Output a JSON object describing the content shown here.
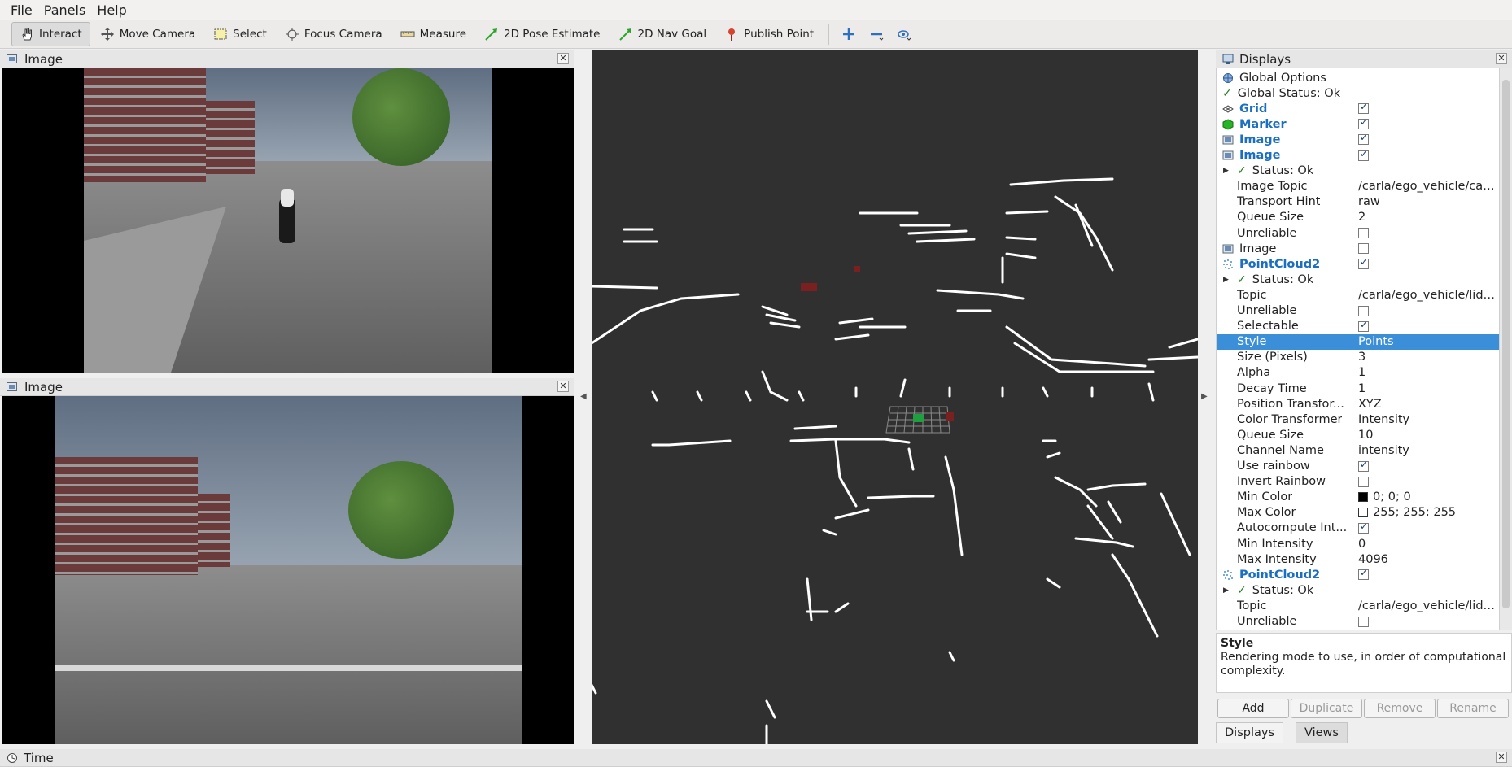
{
  "menu": [
    "File",
    "Panels",
    "Help"
  ],
  "toolbar": {
    "tools": [
      {
        "label": "Interact",
        "icon": "hand-icon",
        "active": true
      },
      {
        "label": "Move Camera",
        "icon": "move-camera-icon"
      },
      {
        "label": "Select",
        "icon": "select-box-icon"
      },
      {
        "label": "Focus Camera",
        "icon": "focus-camera-icon"
      },
      {
        "label": "Measure",
        "icon": "ruler-icon"
      },
      {
        "label": "2D Pose Estimate",
        "icon": "green-arrow-icon"
      },
      {
        "label": "2D Nav Goal",
        "icon": "green-arrow-icon"
      },
      {
        "label": "Publish Point",
        "icon": "pin-icon"
      }
    ],
    "extra_icons": [
      "add-tool-icon",
      "remove-tool-icon",
      "view-options-icon"
    ]
  },
  "image_panels": [
    {
      "title": "Image"
    },
    {
      "title": "Image"
    }
  ],
  "displays": {
    "title": "Displays",
    "rows": [
      {
        "name": "Global Options",
        "icon": "globe-icon"
      },
      {
        "name": "Global Status: Ok",
        "icon": "check-icon"
      },
      {
        "name": "Grid",
        "icon": "grid-icon",
        "display": true,
        "checked": true
      },
      {
        "name": "Marker",
        "icon": "marker-cube-icon",
        "display": true,
        "checked": true
      },
      {
        "name": "Image",
        "icon": "image-icon",
        "display": true,
        "checked": true
      },
      {
        "name": "Image",
        "icon": "image-icon",
        "display": true,
        "checked": true
      },
      {
        "name": "Status: Ok",
        "sub": true,
        "expander": true,
        "icon": "check-icon"
      },
      {
        "name": "Image Topic",
        "sub": true,
        "value": "/carla/ego_vehicle/cam..."
      },
      {
        "name": "Transport Hint",
        "sub": true,
        "value": "raw"
      },
      {
        "name": "Queue Size",
        "sub": true,
        "value": "2"
      },
      {
        "name": "Unreliable",
        "sub": true,
        "checked": false
      },
      {
        "name": "Image",
        "icon": "image-icon",
        "plain": true,
        "checked": false
      },
      {
        "name": "PointCloud2",
        "icon": "pointcloud-icon",
        "display": true,
        "checked": true
      },
      {
        "name": "Status: Ok",
        "sub": true,
        "expander": true,
        "icon": "check-icon"
      },
      {
        "name": "Topic",
        "sub": true,
        "value": "/carla/ego_vehicle/lida..."
      },
      {
        "name": "Unreliable",
        "sub": true,
        "checked": false
      },
      {
        "name": "Selectable",
        "sub": true,
        "checked": true
      },
      {
        "name": "Style",
        "sub": true,
        "value": "Points",
        "selected": true
      },
      {
        "name": "Size (Pixels)",
        "sub": true,
        "value": "3"
      },
      {
        "name": "Alpha",
        "sub": true,
        "value": "1"
      },
      {
        "name": "Decay Time",
        "sub": true,
        "value": "1"
      },
      {
        "name": "Position Transfor...",
        "sub": true,
        "value": "XYZ"
      },
      {
        "name": "Color Transformer",
        "sub": true,
        "value": "Intensity"
      },
      {
        "name": "Queue Size",
        "sub": true,
        "value": "10"
      },
      {
        "name": "Channel Name",
        "sub": true,
        "value": "intensity"
      },
      {
        "name": "Use rainbow",
        "sub": true,
        "checked": true
      },
      {
        "name": "Invert Rainbow",
        "sub": true,
        "checked": false
      },
      {
        "name": "Min Color",
        "sub": true,
        "value": "0; 0; 0",
        "swatch": "#000000"
      },
      {
        "name": "Max Color",
        "sub": true,
        "value": "255; 255; 255",
        "swatch": "#ffffff"
      },
      {
        "name": "Autocompute Int...",
        "sub": true,
        "checked": true
      },
      {
        "name": "Min Intensity",
        "sub": true,
        "value": "0"
      },
      {
        "name": "Max Intensity",
        "sub": true,
        "value": "4096"
      },
      {
        "name": "PointCloud2",
        "icon": "pointcloud-icon",
        "display": true,
        "checked": true
      },
      {
        "name": "Status: Ok",
        "sub": true,
        "expander": true,
        "icon": "check-icon"
      },
      {
        "name": "Topic",
        "sub": true,
        "value": "/carla/ego_vehicle/lida..."
      },
      {
        "name": "Unreliable",
        "sub": true,
        "checked": false
      }
    ]
  },
  "description": {
    "title": "Style",
    "text": "Rendering mode to use, in order of computational complexity."
  },
  "buttons": {
    "add": "Add",
    "duplicate": "Duplicate",
    "remove": "Remove",
    "rename": "Rename"
  },
  "tabs": {
    "displays": "Displays",
    "views": "Views"
  },
  "time_panel": {
    "title": "Time"
  },
  "colors": {
    "selection": "#3b8fd8",
    "render_bg": "#303030",
    "display_name": "#1a6fc2"
  }
}
